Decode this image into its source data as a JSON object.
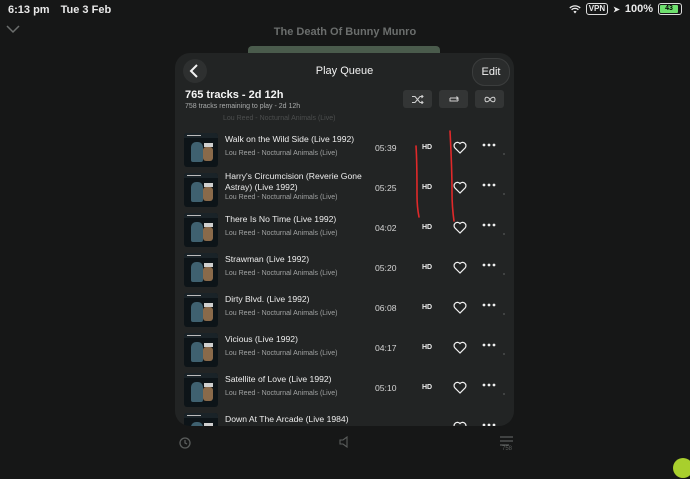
{
  "status_bar": {
    "time": "6:13 pm",
    "date": "Tue 3 Feb",
    "vpn": "VPN",
    "battery_percent": "100%",
    "battery_level": "43"
  },
  "background": {
    "now_playing_title": "The Death Of Bunny Munro",
    "queue_count_badge": "758"
  },
  "queue": {
    "title": "Play Queue",
    "edit_label": "Edit",
    "summary": "765 tracks - 2d 12h",
    "remaining": "758 tracks remaining to play - 2d 12h",
    "partial_previous_row": "Lou Reed - Nocturnal Animals (Live)",
    "modes": [
      "shuffle-icon",
      "repeat-icon",
      "infinity-icon"
    ],
    "tracks": [
      {
        "title": "Walk on the Wild Side (Live 1992)",
        "artist_album": "Lou Reed - Nocturnal Animals (Live)",
        "duration": "05:39",
        "quality": "HD"
      },
      {
        "title": "Harry's Circumcision (Reverie Gone Astray) (Live 1992)",
        "artist_album": "Lou Reed - Nocturnal Animals (Live)",
        "duration": "05:25",
        "quality": "HD"
      },
      {
        "title": "There Is No Time (Live 1992)",
        "artist_album": "Lou Reed - Nocturnal Animals (Live)",
        "duration": "04:02",
        "quality": "HD"
      },
      {
        "title": "Strawman (Live 1992)",
        "artist_album": "Lou Reed - Nocturnal Animals (Live)",
        "duration": "05:20",
        "quality": "HD"
      },
      {
        "title": "Dirty Blvd. (Live 1992)",
        "artist_album": "Lou Reed - Nocturnal Animals (Live)",
        "duration": "06:08",
        "quality": "HD"
      },
      {
        "title": "Vicious (Live 1992)",
        "artist_album": "Lou Reed - Nocturnal Animals (Live)",
        "duration": "04:17",
        "quality": "HD"
      },
      {
        "title": "Satellite of Love (Live 1992)",
        "artist_album": "Lou Reed - Nocturnal Animals (Live)",
        "duration": "05:10",
        "quality": "HD"
      },
      {
        "title": "Down At The Arcade (Live 1984)",
        "artist_album": "",
        "duration": "",
        "quality": ""
      }
    ]
  },
  "colors": {
    "background": "#161717",
    "sheet": "#222424",
    "annotation": "#e0292a",
    "battery": "#6ee06e"
  }
}
